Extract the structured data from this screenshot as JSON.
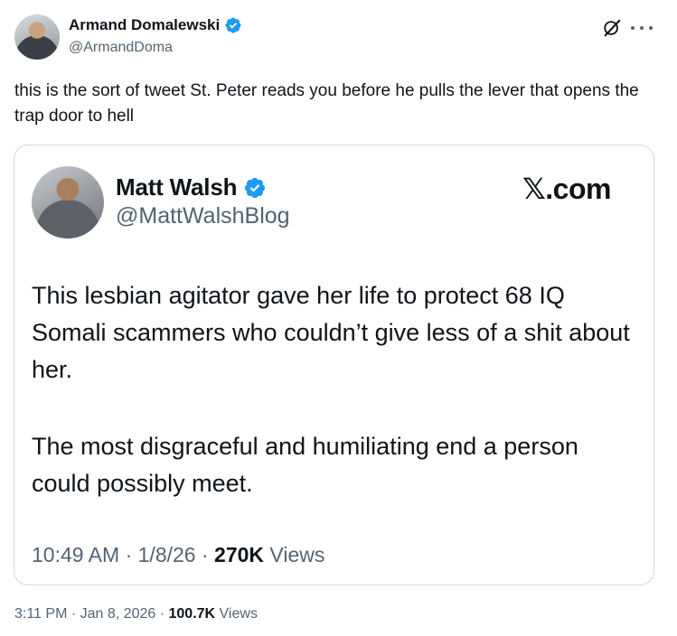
{
  "tweet": {
    "author_name": "Armand Domalewski",
    "author_handle": "@ArmandDoma",
    "text": "this is the sort of tweet St. Peter reads you before he pulls the lever that opens the trap door to hell",
    "time": "3:11 PM",
    "date": "Jan 8, 2026",
    "views_count": "100.7K",
    "views_label": "Views",
    "sep": "·"
  },
  "quoted": {
    "author_name": "Matt Walsh",
    "author_handle": "@MattWalshBlog",
    "source_label": "𝕏.com",
    "paragraph1": "This lesbian agitator gave her life to protect 68 IQ Somali scammers who couldn’t give less of a shit about her.",
    "paragraph2": "The most disgraceful and humiliating end a person could possibly meet.",
    "time": "10:49 AM",
    "date": "1/8/26",
    "views_count": "270K",
    "views_label": "Views",
    "sep": "·"
  },
  "icons": {
    "verified": "verified-badge-icon",
    "grok": "grok-icon",
    "more": "more-icon"
  },
  "colors": {
    "verified_blue": "#1d9bf0",
    "secondary_text": "#536471",
    "primary_text": "#0f1419",
    "border": "#cfd9de"
  }
}
